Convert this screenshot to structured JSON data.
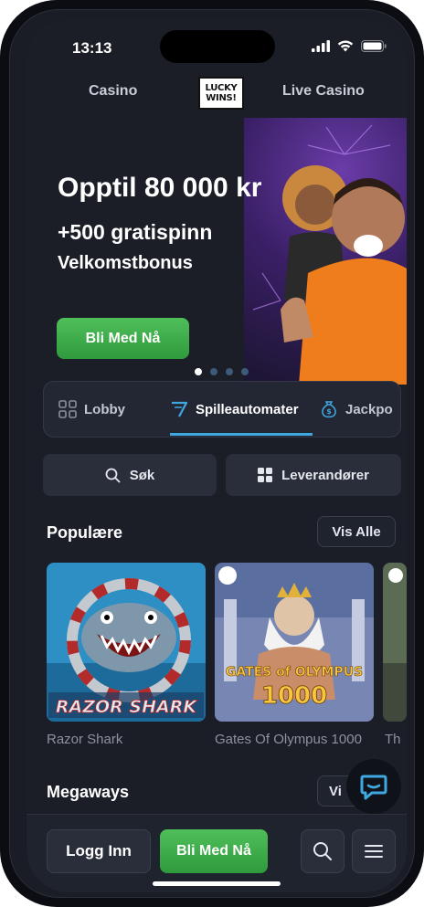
{
  "status_bar": {
    "time": "13:13"
  },
  "top_nav": {
    "left": "Casino",
    "right": "Live Casino",
    "logo_line1": "LUCKY",
    "logo_line2": "WINS!"
  },
  "hero": {
    "title": "Opptil 80 000 kr",
    "subtitle": "+500 gratispinn",
    "subtitle2": "Velkomstbonus",
    "cta": "Bli Med Nå",
    "slides": 4,
    "active_slide": 1
  },
  "categories": {
    "items": [
      {
        "label": "Lobby",
        "icon": "grid-icon"
      },
      {
        "label": "Spilleautomater",
        "icon": "seven-icon",
        "active": true
      },
      {
        "label": "Jackpo",
        "icon": "money-bag-icon"
      }
    ]
  },
  "actions": {
    "search": "Søk",
    "providers": "Leverandører"
  },
  "sections": {
    "popular": {
      "title": "Populære",
      "see_all": "Vis Alle",
      "games": [
        "Razor Shark",
        "Gates Of Olympus 1000",
        "Th"
      ]
    },
    "megaways": {
      "title": "Megaways",
      "see_all": "Vi"
    }
  },
  "game_art": {
    "razor_title": "RAZOR SHARK",
    "olympus_title1": "GATES of OLYMPUS",
    "olympus_title2": "1000"
  },
  "bottom_bar": {
    "login": "Logg Inn",
    "join": "Bli Med Nå"
  },
  "colors": {
    "accent_green": "#3aab48",
    "accent_blue": "#3fa8e0",
    "background": "#1b1e27"
  }
}
